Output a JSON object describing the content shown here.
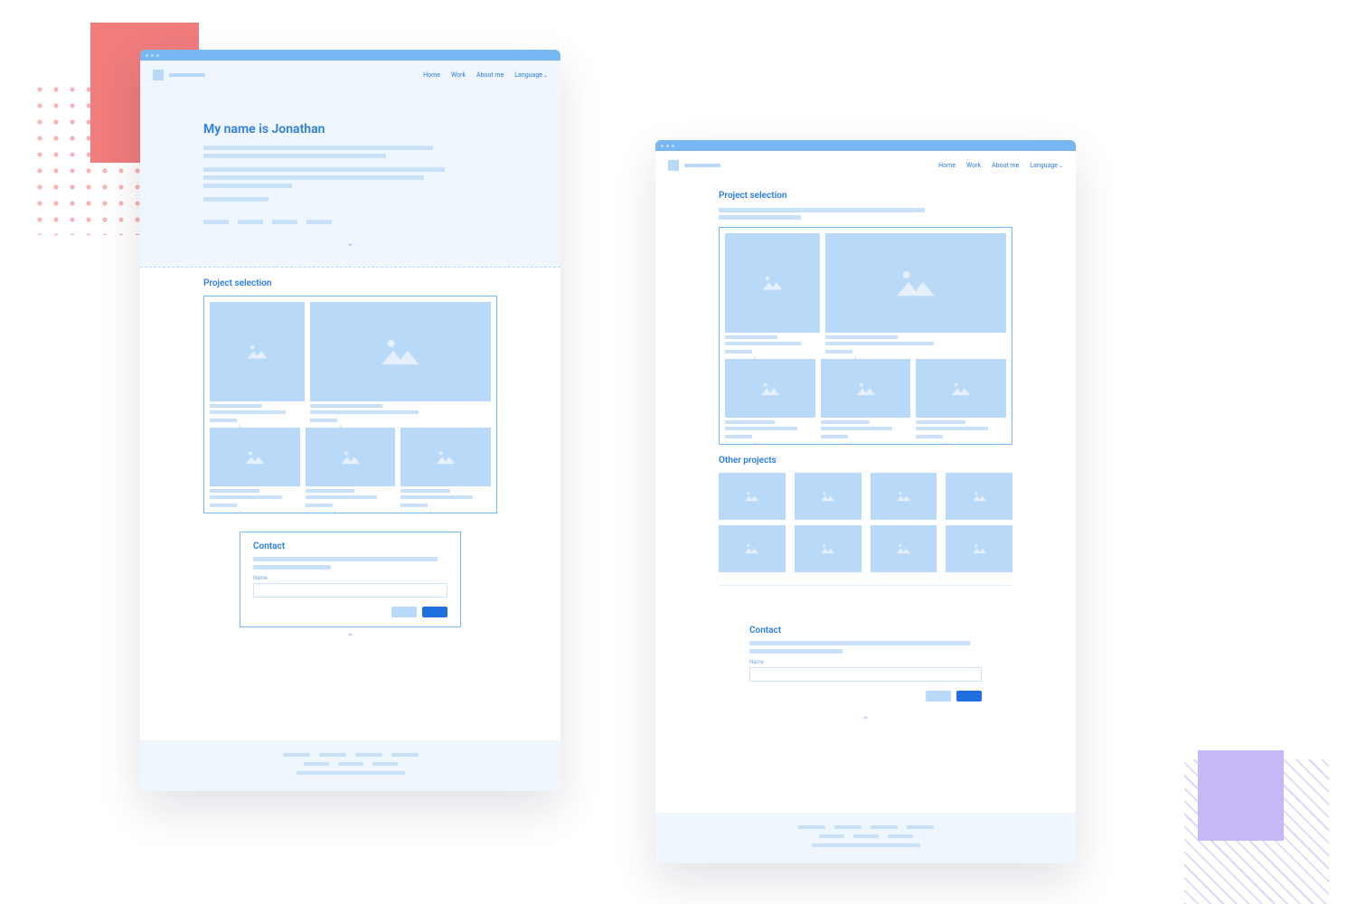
{
  "nav": {
    "items": [
      "Home",
      "Work",
      "About me",
      "Language"
    ],
    "language_has_dropdown": true
  },
  "hero": {
    "title": "My name is Jonathan"
  },
  "sections": {
    "project_selection": "Project selection",
    "other_projects": "Other projects",
    "contact": "Contact"
  },
  "contact": {
    "field_label": "Name"
  },
  "colors": {
    "accent": "#2a7de1",
    "light": "#b9d9f8",
    "pale": "#eff6fe",
    "titlebar": "#77b7f2",
    "primary_button": "#1f6fe0",
    "deco_red": "#f07c7c",
    "deco_purple": "#c6b8f7"
  },
  "icons": {
    "image_placeholder": "mountain-sun",
    "expand_down": "chevron-down",
    "collapse_up": "chevron-up",
    "more_arrow": "chevron-right"
  }
}
